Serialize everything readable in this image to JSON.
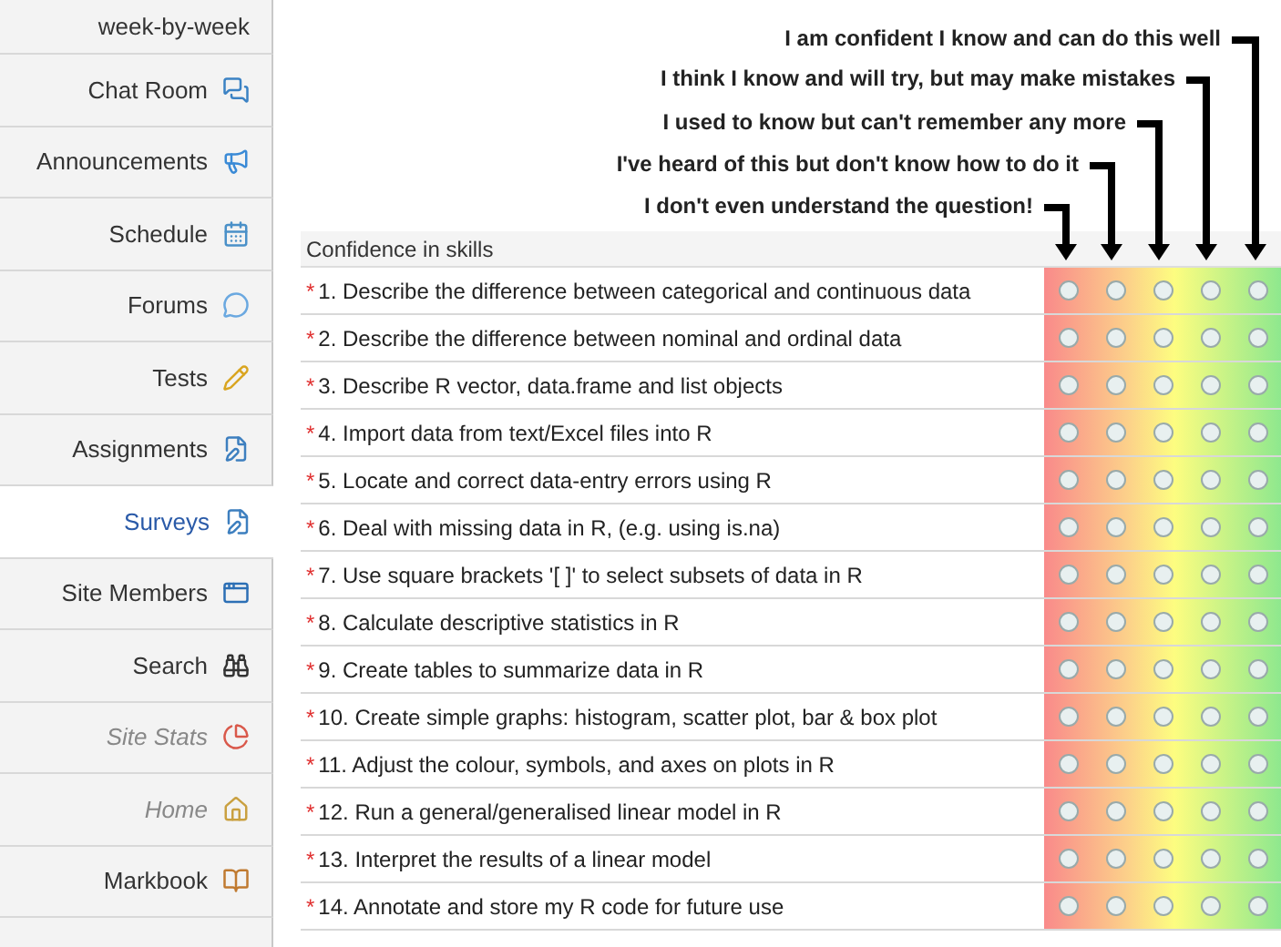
{
  "sidebar": {
    "items": [
      {
        "label": "week-by-week",
        "selected": false,
        "hidden": false
      },
      {
        "label": "Chat Room",
        "selected": false,
        "hidden": false
      },
      {
        "label": "Announcements",
        "selected": false,
        "hidden": false
      },
      {
        "label": "Schedule",
        "selected": false,
        "hidden": false
      },
      {
        "label": "Forums",
        "selected": false,
        "hidden": false
      },
      {
        "label": "Tests",
        "selected": false,
        "hidden": false
      },
      {
        "label": "Assignments",
        "selected": false,
        "hidden": false
      },
      {
        "label": "Surveys",
        "selected": true,
        "hidden": false
      },
      {
        "label": "Site Members",
        "selected": false,
        "hidden": false
      },
      {
        "label": "Search",
        "selected": false,
        "hidden": false
      },
      {
        "label": "Site Stats",
        "selected": false,
        "hidden": true
      },
      {
        "label": "Home",
        "selected": false,
        "hidden": true
      },
      {
        "label": "Markbook",
        "selected": false,
        "hidden": false
      }
    ]
  },
  "legend": [
    "I am confident I know and can do this well",
    "I think I know and will try, but may make mistakes",
    "I used to know but can't remember any more",
    "I've heard of this but don't know how to do it",
    "I don't even understand the question!"
  ],
  "survey": {
    "title": "Confidence in skills",
    "questions": [
      {
        "mark": "*",
        "text": "1. Describe the difference between categorical and continuous data",
        "options": [
          {
            "selected": false
          },
          {
            "selected": false
          },
          {
            "selected": false
          },
          {
            "selected": false
          },
          {
            "selected": false
          }
        ]
      },
      {
        "mark": "*",
        "text": "2. Describe the difference between nominal and ordinal data",
        "options": [
          {
            "selected": false
          },
          {
            "selected": false
          },
          {
            "selected": false
          },
          {
            "selected": false
          },
          {
            "selected": false
          }
        ]
      },
      {
        "mark": "*",
        "text": "3. Describe R vector, data.frame and list objects",
        "options": [
          {
            "selected": false
          },
          {
            "selected": false
          },
          {
            "selected": false
          },
          {
            "selected": false
          },
          {
            "selected": false
          }
        ]
      },
      {
        "mark": "*",
        "text": "4. Import data from text/Excel files into R",
        "options": [
          {
            "selected": false
          },
          {
            "selected": false
          },
          {
            "selected": false
          },
          {
            "selected": false
          },
          {
            "selected": false
          }
        ]
      },
      {
        "mark": "*",
        "text": "5. Locate and correct data-entry errors using R",
        "options": [
          {
            "selected": false
          },
          {
            "selected": false
          },
          {
            "selected": false
          },
          {
            "selected": false
          },
          {
            "selected": false
          }
        ]
      },
      {
        "mark": "*",
        "text": "6. Deal with missing data in R, (e.g. using is.na)",
        "options": [
          {
            "selected": false
          },
          {
            "selected": false
          },
          {
            "selected": false
          },
          {
            "selected": false
          },
          {
            "selected": false
          }
        ]
      },
      {
        "mark": "*",
        "text": "7. Use square brackets '[ ]' to select subsets of data in R",
        "options": [
          {
            "selected": false
          },
          {
            "selected": false
          },
          {
            "selected": false
          },
          {
            "selected": false
          },
          {
            "selected": false
          }
        ]
      },
      {
        "mark": "*",
        "text": "8. Calculate descriptive statistics in R",
        "options": [
          {
            "selected": false
          },
          {
            "selected": false
          },
          {
            "selected": false
          },
          {
            "selected": false
          },
          {
            "selected": false
          }
        ]
      },
      {
        "mark": "*",
        "text": "9. Create tables to summarize data in R",
        "options": [
          {
            "selected": false
          },
          {
            "selected": false
          },
          {
            "selected": false
          },
          {
            "selected": false
          },
          {
            "selected": false
          }
        ]
      },
      {
        "mark": "*",
        "text": "10. Create simple graphs: histogram, scatter plot, bar & box plot",
        "options": [
          {
            "selected": false
          },
          {
            "selected": false
          },
          {
            "selected": false
          },
          {
            "selected": false
          },
          {
            "selected": false
          }
        ]
      },
      {
        "mark": "*",
        "text": "11. Adjust the colour, symbols, and axes on plots in R",
        "options": [
          {
            "selected": false
          },
          {
            "selected": false
          },
          {
            "selected": false
          },
          {
            "selected": false
          },
          {
            "selected": false
          }
        ]
      },
      {
        "mark": "*",
        "text": "12. Run a general/generalised linear model in R",
        "options": [
          {
            "selected": false
          },
          {
            "selected": false
          },
          {
            "selected": false
          },
          {
            "selected": false
          },
          {
            "selected": false
          }
        ]
      },
      {
        "mark": "*",
        "text": "13. Interpret the results of a linear model",
        "options": [
          {
            "selected": false
          },
          {
            "selected": false
          },
          {
            "selected": false
          },
          {
            "selected": false
          },
          {
            "selected": false
          }
        ]
      },
      {
        "mark": "*",
        "text": "14. Annotate and store my R code for future use",
        "options": [
          {
            "selected": false
          },
          {
            "selected": false
          },
          {
            "selected": false
          },
          {
            "selected": false
          },
          {
            "selected": false
          }
        ]
      }
    ]
  }
}
